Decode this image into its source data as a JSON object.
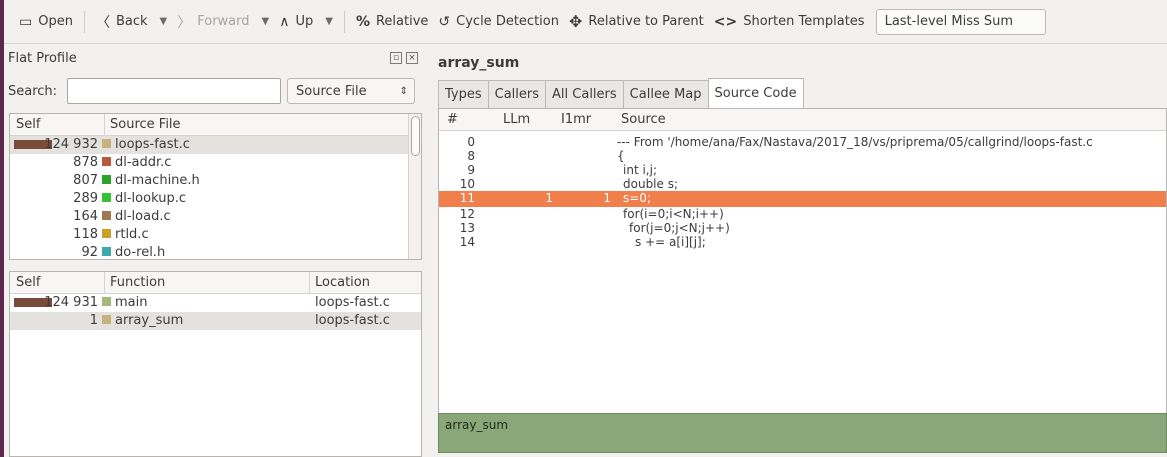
{
  "toolbar": {
    "open": "Open",
    "back": "Back",
    "forward": "Forward",
    "up": "Up",
    "relative": "Relative",
    "cycle": "Cycle Detection",
    "relparent": "Relative to Parent",
    "shorten": "Shorten Templates",
    "event": "Last-level Miss Sum"
  },
  "flat": {
    "title": "Flat Profile",
    "search_label": "Search:",
    "group": "Source File"
  },
  "files": {
    "headers": [
      "Self",
      "Source File"
    ],
    "rows": [
      {
        "self": "124 932",
        "name": "loops-fast.c",
        "color": "#c8b27e"
      },
      {
        "self": "878",
        "name": "dl-addr.c",
        "color": "#b85a3a"
      },
      {
        "self": "807",
        "name": "dl-machine.h",
        "color": "#2aa52a"
      },
      {
        "self": "289",
        "name": "dl-lookup.c",
        "color": "#36c236"
      },
      {
        "self": "164",
        "name": "dl-load.c",
        "color": "#a07850"
      },
      {
        "self": "118",
        "name": "rtld.c",
        "color": "#c8a02a"
      },
      {
        "self": "92",
        "name": "do-rel.h",
        "color": "#40a8a8"
      }
    ]
  },
  "functions": {
    "headers": [
      "Self",
      "Function",
      "Location"
    ],
    "rows": [
      {
        "self": "124 931",
        "name": "main",
        "loc": "loops-fast.c",
        "color": "#a3b87a"
      },
      {
        "self": "1",
        "name": "array_sum",
        "loc": "loops-fast.c",
        "color": "#c8b27e"
      }
    ]
  },
  "detail": {
    "function": "array_sum",
    "tabs": [
      "Types",
      "Callers",
      "All Callers",
      "Callee Map",
      "Source Code"
    ],
    "headers": [
      "#",
      "LLm",
      "I1mr",
      "Source"
    ],
    "rows": [
      {
        "n": "0",
        "llm": "",
        "i1": "",
        "src": "--- From '/home/ana/Fax/Nastava/2017_18/vs/priprema/05/callgrind/loops-fast.c"
      },
      {
        "n": "8",
        "llm": "",
        "i1": "",
        "src": "{"
      },
      {
        "n": "9",
        "llm": "",
        "i1": "",
        "src": "int i,j;"
      },
      {
        "n": "10",
        "llm": "",
        "i1": "",
        "src": "double s;"
      },
      {
        "n": "11",
        "llm": "1",
        "i1": "1",
        "src": "s=0;"
      },
      {
        "n": "12",
        "llm": "",
        "i1": "",
        "src": "for(i=0;i<N;i++)"
      },
      {
        "n": "13",
        "llm": "",
        "i1": "",
        "src": "for(j=0;j<N;j++)"
      },
      {
        "n": "14",
        "llm": "",
        "i1": "",
        "src": "s += a[i][j];"
      }
    ],
    "info": "array_sum"
  }
}
